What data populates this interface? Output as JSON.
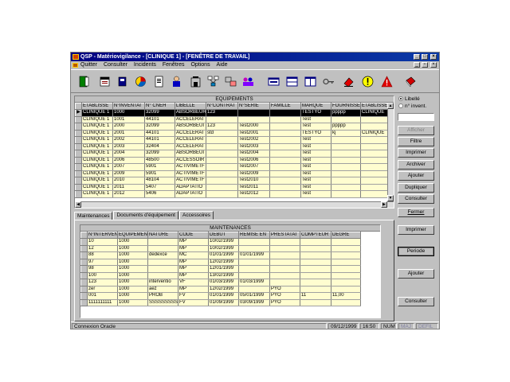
{
  "window": {
    "title": "QSP - Matériovigilance - [CLINIQUE 1] - [FENÊTRE DE TRAVAIL]",
    "controls": [
      "_",
      "□",
      "×"
    ],
    "doc_controls": [
      "_",
      "▫",
      "×"
    ]
  },
  "menu": [
    "Quitter",
    "Consulter",
    "Incidents",
    "Fenêtres",
    "Options",
    "Aide"
  ],
  "toolbar": {
    "icons": [
      "exit-door-icon",
      "agenda-icon",
      "book-icon",
      "pie-chart-icon",
      "document-icon",
      "user-icon",
      "building-icon",
      "network-icon",
      "computer-network-icon",
      "people-icon",
      "layout-cols2-icon",
      "layout-rows-icon",
      "layout-cols-icon",
      "key-icon",
      "eraser-icon",
      "info-alert-icon",
      "warning-icon",
      "red-book-icon"
    ]
  },
  "equipements": {
    "caption": "EQUIPEMENTS",
    "columns": [
      "ETABLISSE",
      "N°INVENTAI",
      "N° CNEH",
      "LIBELLE",
      "N°CONTRAT",
      "N°SERIE",
      "FAMILLE",
      "MARQUE",
      "FOURNISSE",
      "ETABLISSE"
    ],
    "selected_row": 0,
    "rows": [
      [
        "CLINIQUE 1",
        "1000",
        "32099",
        "ABSORBEUR",
        "123",
        "",
        "",
        "TESTYO",
        "ppppp",
        "CLINIQUE"
      ],
      [
        "CLINIQUE 1",
        "1001",
        "44101",
        "ACCELERAT",
        "",
        "",
        "",
        "Test",
        "",
        ""
      ],
      [
        "CLINIQUE 1",
        "2000",
        "32099",
        "ABSORBEUI",
        "123",
        "Test2000",
        "",
        "Test",
        "ppppp",
        ""
      ],
      [
        "CLINIQUE 1",
        "2001",
        "44101",
        "ACCELERAT",
        "std",
        "Test2001",
        "",
        "TESTYO",
        "kj",
        "CLINIQUE"
      ],
      [
        "CLINIQUE 1",
        "2002",
        "44101",
        "ACCELERAT",
        "",
        "Test2002",
        "",
        "Test",
        "",
        ""
      ],
      [
        "CLINIQUE 1",
        "2003",
        "32404",
        "ACCELERAT",
        "",
        "Test2003",
        "",
        "Test",
        "",
        ""
      ],
      [
        "CLINIQUE 1",
        "2004",
        "32099",
        "ABSORBEUI",
        "",
        "Test2004",
        "",
        "Test",
        "",
        ""
      ],
      [
        "CLINIQUE 1",
        "2006",
        "48500",
        "ACCESSOIR",
        "",
        "Test2006",
        "",
        "Test",
        "",
        ""
      ],
      [
        "CLINIQUE 1",
        "2007",
        "5901",
        "ACTIVIMETF",
        "",
        "Test2007",
        "",
        "Test",
        "",
        ""
      ],
      [
        "CLINIQUE 1",
        "2009",
        "5901",
        "ACTIVIMETF",
        "",
        "Test2009",
        "",
        "Test",
        "",
        ""
      ],
      [
        "CLINIQUE 1",
        "2010",
        "48104",
        "ACTIVIMETF",
        "",
        "Test2010",
        "",
        "Test",
        "",
        ""
      ],
      [
        "CLINIQUE 1",
        "2011",
        "5407",
        "ADAPTATIO",
        "",
        "Test2011",
        "",
        "Test",
        "",
        ""
      ],
      [
        "CLINIQUE 1",
        "2012",
        "5406",
        "ADAPTATIO",
        "",
        "Test2012",
        "",
        "Test",
        "",
        ""
      ]
    ]
  },
  "right_panel": {
    "radio_libelle": "Libellé",
    "radio_inventaire": "n° invent.",
    "libelle_value": "",
    "buttons": [
      "Afficher",
      "Filtre",
      "Imprimer",
      "Archiver",
      "Ajouter",
      "Dupliquer",
      "Consulter"
    ],
    "fermer": "Fermer",
    "imprimer2": "Imprimer",
    "periode": "Periode",
    "ajouter2": "Ajouter",
    "consulter2": "Consulter"
  },
  "tabs": [
    "Maintenances",
    "Documents d'équipement",
    "Accessoires"
  ],
  "maintenances": {
    "caption": "MAINTENANCES",
    "columns": [
      "N°INTERVEN",
      "EQUIPEMEN",
      "NATURE",
      "CODE",
      "DEBUT",
      "REMISE EN",
      "PRESTATAI",
      "COMPTEUR",
      "DEGRE"
    ],
    "rows": [
      [
        "10",
        "1000",
        "",
        "MP",
        "10/02/1999",
        "",
        "",
        "",
        ""
      ],
      [
        "12",
        "1000",
        "",
        "MP",
        "10/02/1999",
        "",
        "",
        "",
        ""
      ],
      [
        "88",
        "1000",
        "dedexce",
        "MC",
        "01/01/1999",
        "01/01/1999",
        "",
        "",
        ""
      ],
      [
        "97",
        "1000",
        "",
        "MP",
        "12/02/1999",
        "",
        "",
        "",
        ""
      ],
      [
        "98",
        "1000",
        "",
        "MP",
        "12/01/1999",
        "",
        "",
        "",
        ""
      ],
      [
        "100",
        "1000",
        "",
        "MP",
        "13/02/1999",
        "",
        "",
        "",
        ""
      ],
      [
        "123",
        "1000",
        "interventio",
        "VF",
        "01/03/1999",
        "01/03/1999",
        "",
        "",
        ""
      ],
      [
        "zer",
        "1000",
        "aez",
        "MP",
        "12/02/1999",
        "",
        "PYO",
        "",
        ""
      ],
      [
        "001",
        "1000",
        "PROB",
        "FV",
        "01/01/1999",
        "05/01/1999",
        "PYO",
        "11",
        "11,00"
      ],
      [
        "1111111111",
        "1000",
        "SSSSSSSSS",
        "FV",
        "01/09/1999",
        "03/09/1999",
        "PYO",
        "",
        ""
      ]
    ]
  },
  "status": {
    "connection": "Connexion Oracle",
    "date": "09/12/1999",
    "time": "16:50",
    "num": "NUM",
    "maj": "MAJ",
    "defil": "DEFIL"
  }
}
